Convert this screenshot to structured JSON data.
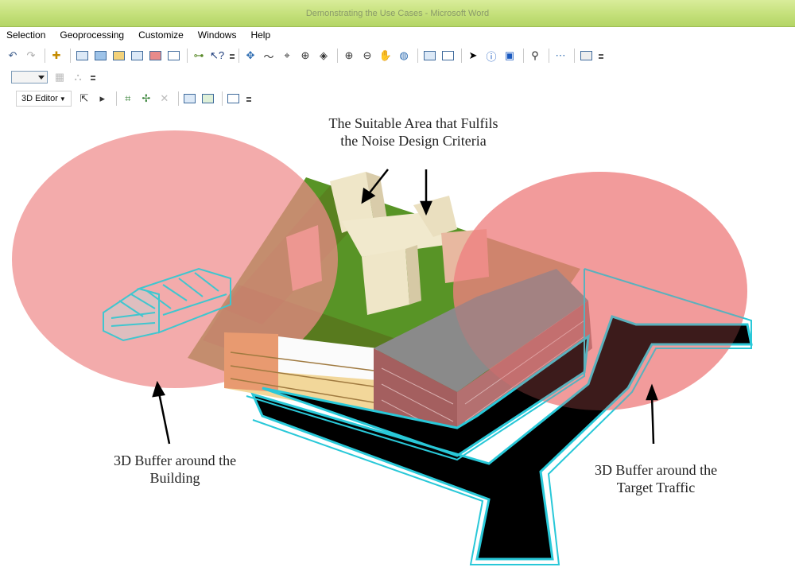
{
  "window": {
    "title": "Demonstrating the Use Cases - Microsoft Word"
  },
  "menu": {
    "items": [
      "Selection",
      "Geoprocessing",
      "Customize",
      "Windows",
      "Help"
    ]
  },
  "toolbar3": {
    "editor_label": "3D Editor"
  },
  "captions": {
    "suitable_area_line1": "The Suitable Area that Fulfils",
    "suitable_area_line2": "the Noise Design Criteria",
    "buffer_building_line1": "3D Buffer around the",
    "buffer_building_line2": "Building",
    "buffer_traffic_line1": "3D Buffer around the",
    "buffer_traffic_line2": "Target Traffic"
  },
  "colors": {
    "buffer_fill": "#ef8a8a",
    "site_green": "#4f8e1a",
    "road_black": "#000000",
    "road_outline": "#29c8d8",
    "wireframe": "#3fc6cf",
    "titlebar": "#c4e07a"
  },
  "icons": {
    "toolbar1": [
      "undo-icon",
      "redo-icon",
      "add-data-icon",
      "map-view-icon",
      "layout-view-icon",
      "catalog-icon",
      "toc-icon",
      "search-window-icon",
      "identify-window-icon",
      "python-icon",
      "model-builder-icon",
      "help-pointer-icon",
      "navigate-icon",
      "fly-icon",
      "center-target-icon",
      "zoom-to-target-icon",
      "observer-icon",
      "zoom-in-icon",
      "zoom-out-icon",
      "pan-icon",
      "full-extent-icon",
      "select-features-icon",
      "clear-selection-icon",
      "select-elements-icon",
      "info-icon",
      "html-popup-icon",
      "find-icon",
      "measure-icon",
      "swipe-icon"
    ]
  }
}
